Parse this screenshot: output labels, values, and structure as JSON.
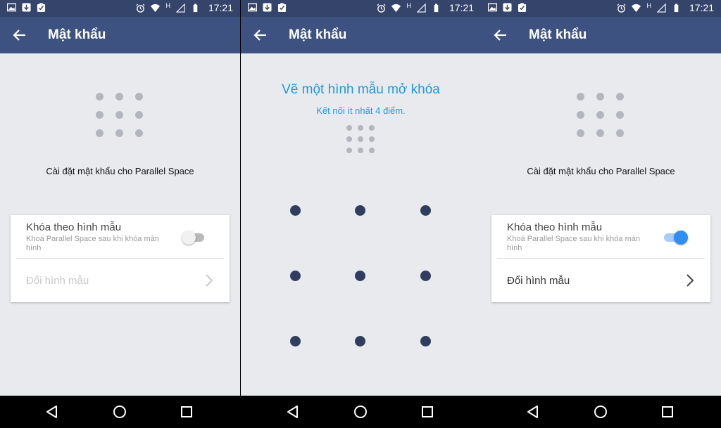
{
  "status_bar": {
    "time": "17:21",
    "network_label": "H"
  },
  "colors": {
    "status_bar": "#34446b",
    "app_bar": "#3d5280",
    "accent": "#1e9ae0",
    "pattern_dot": "#2f3e5f",
    "toggle_on": "#2f8ef2"
  },
  "screens": [
    {
      "title": "Mật khẩu",
      "subtitle": "Cài đặt mật khẩu cho Parallel Space",
      "lock_label": "Khóa theo hình mẫu",
      "lock_desc": "Khoá Parallel Space sau khi khóa màn hình",
      "lock_enabled": false,
      "change_label": "Đổi hình mẫu",
      "change_enabled": false
    },
    {
      "title": "Mật khẩu",
      "heading": "Vẽ một hình mẫu mở khóa",
      "hint": "Kết nối ít nhất 4 điểm."
    },
    {
      "title": "Mật khẩu",
      "subtitle": "Cài đặt mật khẩu cho Parallel Space",
      "lock_label": "Khóa theo hình mẫu",
      "lock_desc": "Khoá Parallel Space sau khi khóa màn hình",
      "lock_enabled": true,
      "change_label": "Đổi hình mẫu",
      "change_enabled": true
    }
  ],
  "icons": {
    "status_left": [
      "image-icon",
      "download-icon",
      "clipboard-check-icon"
    ],
    "status_right": [
      "alarm-icon",
      "wifi-icon",
      "signal-icon",
      "battery-icon"
    ],
    "nav": [
      "back-triangle-icon",
      "home-circle-icon",
      "recents-square-icon"
    ]
  }
}
